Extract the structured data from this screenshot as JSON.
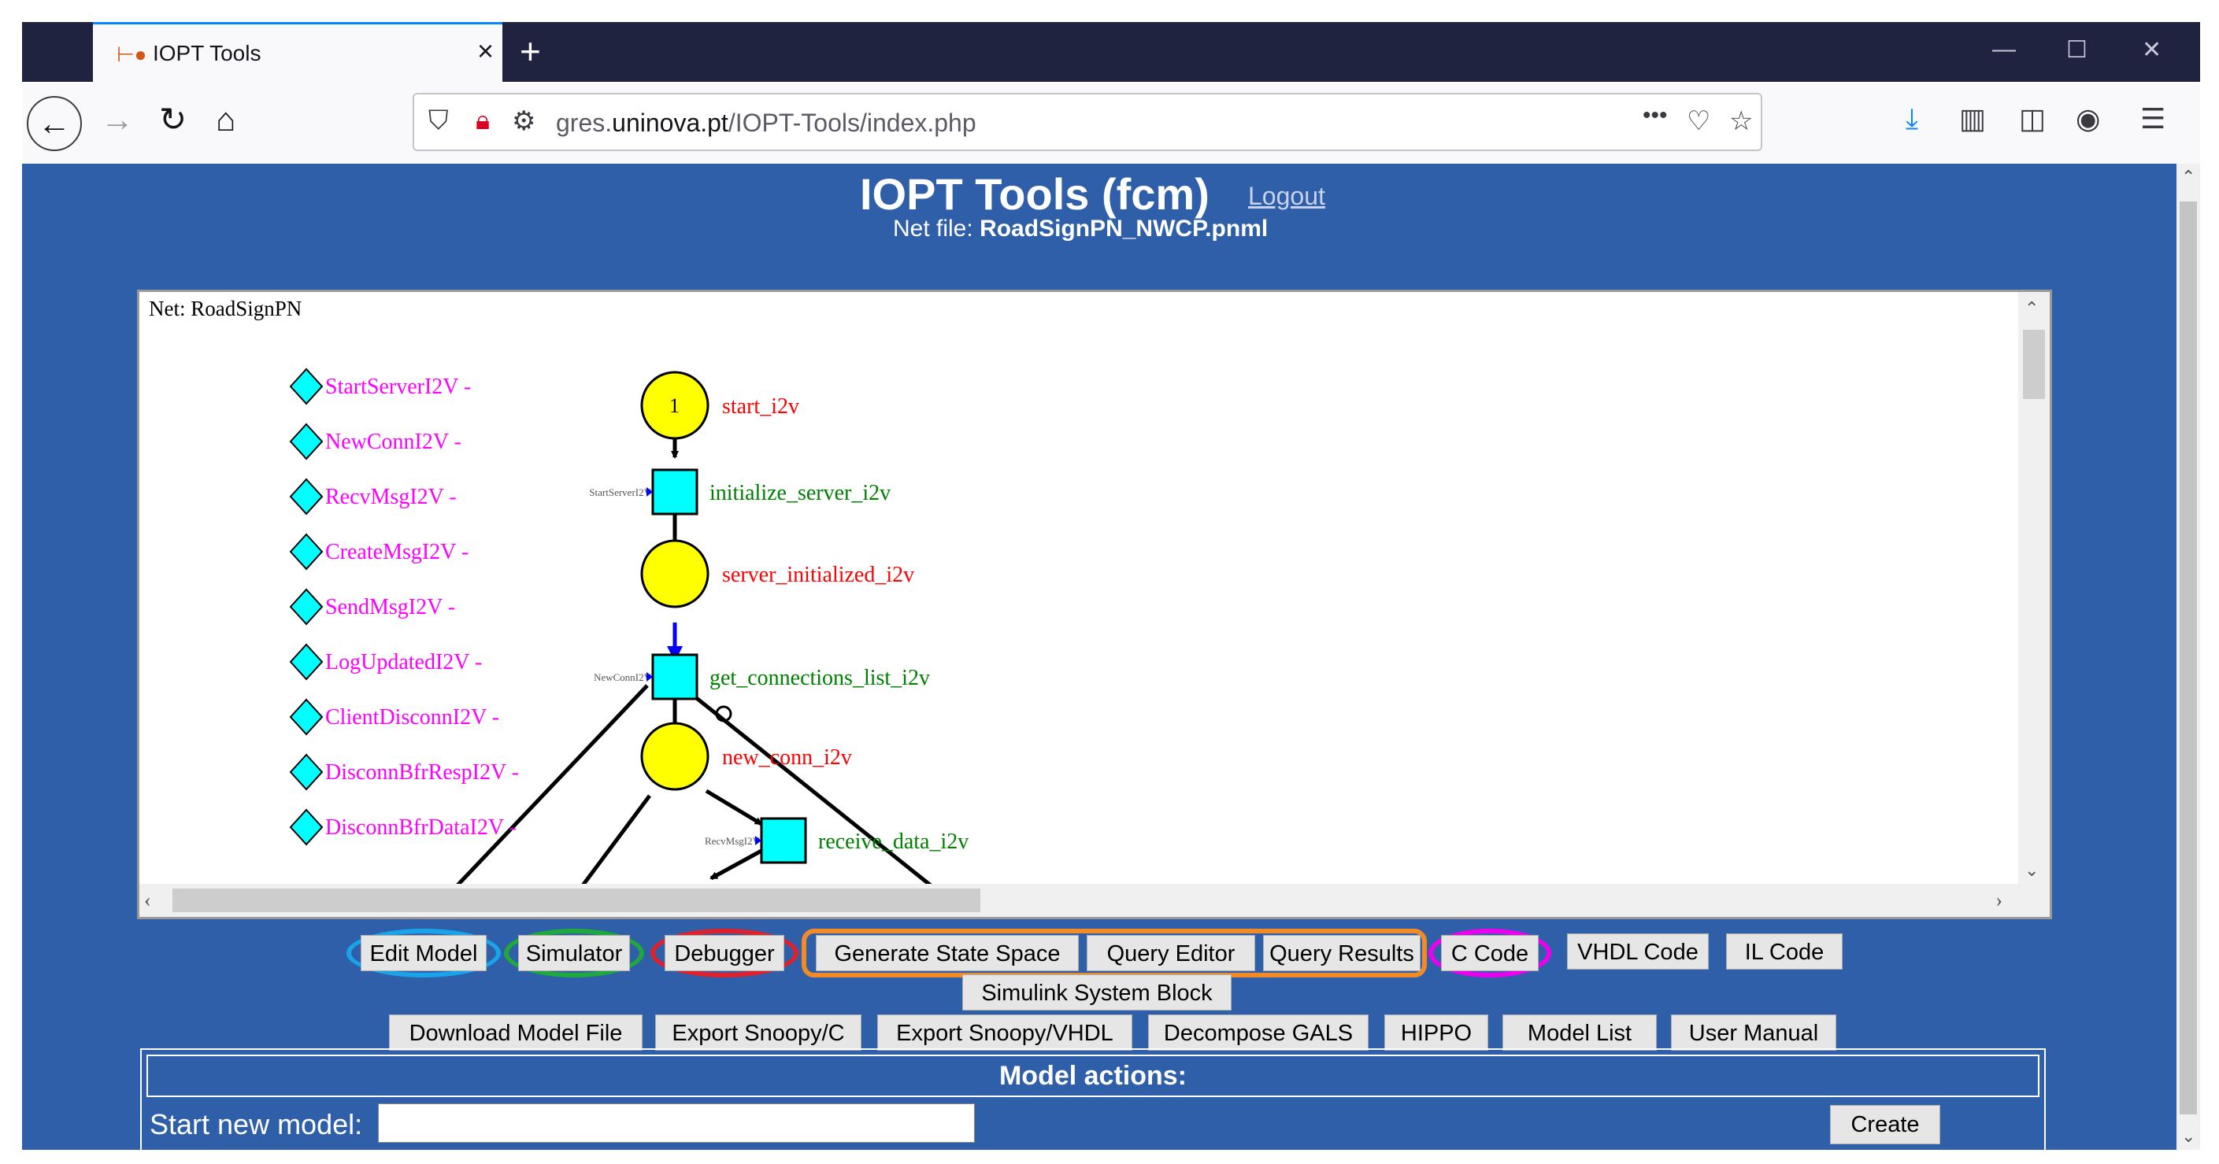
{
  "browser": {
    "tab_title": "IOPT Tools",
    "tab_close": "×",
    "new_tab": "+",
    "url_prefix": "gres.",
    "url_domain": "uninova.pt",
    "url_path": "/IOPT-Tools/index.php",
    "page_actions": "•••",
    "window_controls": {
      "minimize": "—",
      "maximize": "☐",
      "close": "✕"
    }
  },
  "header": {
    "title": "IOPT Tools (fcm)",
    "logout": "Logout",
    "net_file_label": "Net file:",
    "net_file_name": "RoadSignPN_NWCP.pnml"
  },
  "viewer": {
    "net_label": "Net: RoadSignPN",
    "input_signals": [
      "StartServerI2V -",
      "NewConnI2V -",
      "RecvMsgI2V -",
      "CreateMsgI2V -",
      "SendMsgI2V -",
      "LogUpdatedI2V -",
      "ClientDisconnI2V -",
      "DisconnBfrRespI2V -",
      "DisconnBfrDataI2V -"
    ],
    "places": [
      {
        "name": "start_i2v",
        "tokens": "1"
      },
      {
        "name": "server_initialized_i2v"
      },
      {
        "name": "new_conn_i2v"
      }
    ],
    "transitions": [
      {
        "name": "initialize_server_i2v",
        "signal": "StartServerI2V"
      },
      {
        "name": "get_connections_list_i2v",
        "signal": "NewConnI2V"
      },
      {
        "name": "receive_data_i2v",
        "signal": "RecvMsgI2V"
      }
    ]
  },
  "buttons_row1": [
    "Edit Model",
    "Simulator",
    "Debugger",
    "Generate State Space",
    "Query Editor",
    "Query Results",
    "C Code",
    "VHDL Code",
    "IL Code"
  ],
  "buttons_row2": [
    "Simulink System Block"
  ],
  "buttons_row3": [
    "Download Model File",
    "Export Snoopy/C",
    "Export Snoopy/VHDL",
    "Decompose GALS",
    "HIPPO",
    "Model List",
    "User Manual"
  ],
  "model_actions": {
    "title": "Model actions:",
    "start_label": "Start new model:",
    "create": "Create"
  },
  "colors": {
    "page_bg": "#2e5fa8",
    "place_fill": "#ffff00",
    "transition_fill": "#00ffff",
    "signal_text": "#ff00ff",
    "place_label": "#ff0000",
    "transition_label": "#008000",
    "ring_edit": "#1aa3e8",
    "ring_sim": "#1fa83c",
    "ring_debug": "#e0202a",
    "ring_state_space": "#f28a25",
    "ring_c_code": "#ee00ee"
  }
}
